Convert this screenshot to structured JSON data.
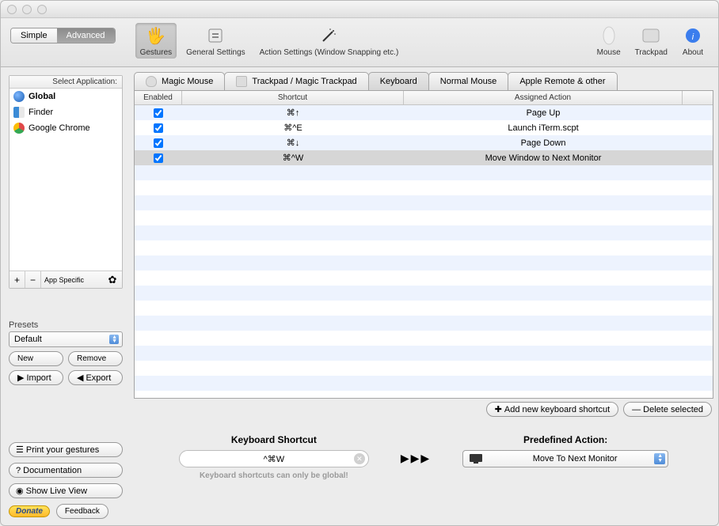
{
  "mode": {
    "simple": "Simple",
    "advanced": "Advanced"
  },
  "toolbar": {
    "gestures": "Gestures",
    "general": "General Settings",
    "action": "Action Settings (Window Snapping etc.)",
    "mouse": "Mouse",
    "trackpad": "Trackpad",
    "about": "About"
  },
  "sidebar": {
    "header": "Select Application:",
    "items": [
      {
        "label": "Global",
        "color": "#3a7bd5"
      },
      {
        "label": "Finder",
        "color": "#4a90d9"
      },
      {
        "label": "Google Chrome",
        "color": "#e04848"
      }
    ],
    "app_specific": "App Specific",
    "presets_label": "Presets",
    "preset_value": "Default",
    "new_btn": "New",
    "remove_btn": "Remove",
    "import_btn": "Import",
    "export_btn": "Export",
    "print": "Print your gestures",
    "docs": "Documentation",
    "live": "Show Live View",
    "donate": "Donate",
    "feedback": "Feedback"
  },
  "tabs": {
    "magic_mouse": "Magic Mouse",
    "trackpad": "Trackpad / Magic Trackpad",
    "keyboard": "Keyboard",
    "normal_mouse": "Normal Mouse",
    "remote": "Apple Remote & other"
  },
  "table": {
    "headers": {
      "enabled": "Enabled",
      "shortcut": "Shortcut",
      "action": "Assigned Action"
    },
    "rows": [
      {
        "shortcut": "⌘↑",
        "action": "Page Up"
      },
      {
        "shortcut": "⌘^E",
        "action": "Launch iTerm.scpt"
      },
      {
        "shortcut": "⌘↓",
        "action": "Page Down"
      },
      {
        "shortcut": "⌘^W",
        "action": "Move Window to Next Monitor"
      }
    ],
    "add_btn": "Add new keyboard shortcut",
    "del_btn": "Delete selected"
  },
  "bottom": {
    "shortcut_title": "Keyboard Shortcut",
    "shortcut_value": "^⌘W",
    "hint": "Keyboard shortcuts can only be global!",
    "action_title": "Predefined Action:",
    "action_value": "Move To Next Monitor"
  }
}
